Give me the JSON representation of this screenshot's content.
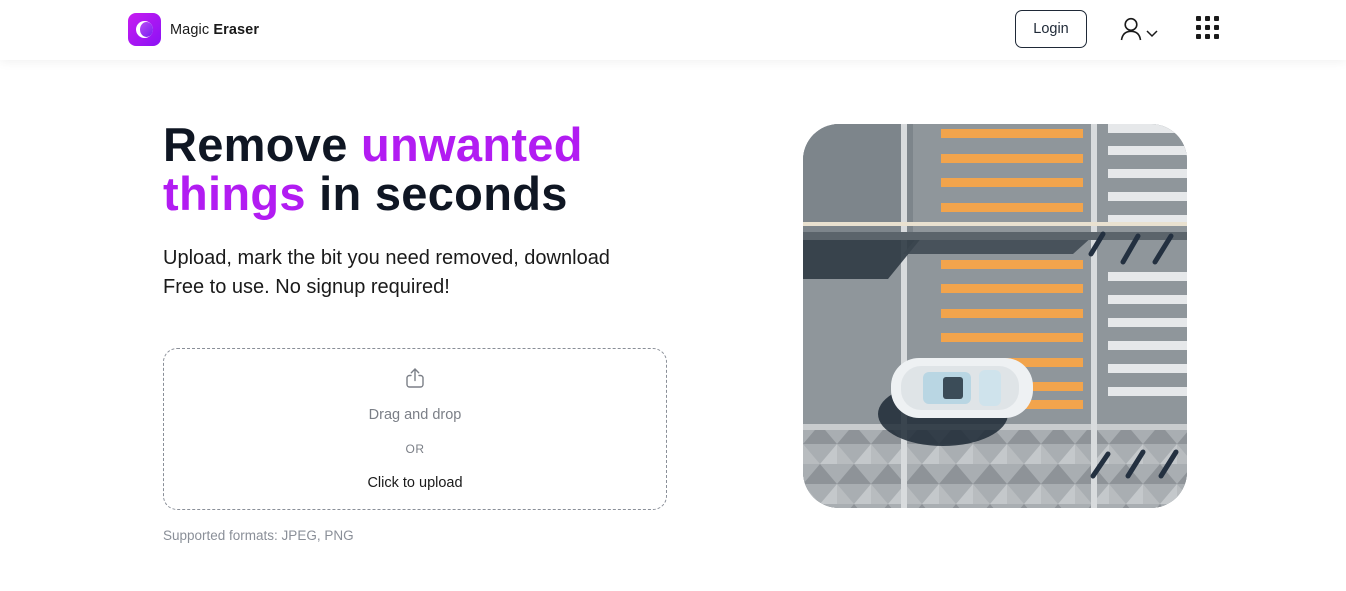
{
  "header": {
    "brand_light": "Magic",
    "brand_bold": "Eraser",
    "login_label": "Login"
  },
  "hero": {
    "title_part1": "Remove ",
    "title_accent1": "unwanted",
    "title_accent2": "things",
    "title_part2": " in seconds",
    "subtitle_line1": "Upload, mark the bit you need removed, download",
    "subtitle_line2": "Free to use. No signup required!"
  },
  "upload": {
    "drag_text": "Drag and drop",
    "or_text": "OR",
    "click_text": "Click to upload",
    "formats_text": "Supported formats: JPEG, PNG"
  },
  "icons": {
    "logo": "magic-eraser-logo-icon",
    "user": "user-icon",
    "chevron": "chevron-down-icon",
    "apps": "grid-icon",
    "upload": "upload-icon"
  },
  "colors": {
    "accent": "#b21cf2",
    "brand_gradient_start": "#c81cf0",
    "brand_gradient_end": "#8a12f5",
    "text_dark": "#0f1623",
    "muted": "#7b7f87"
  }
}
